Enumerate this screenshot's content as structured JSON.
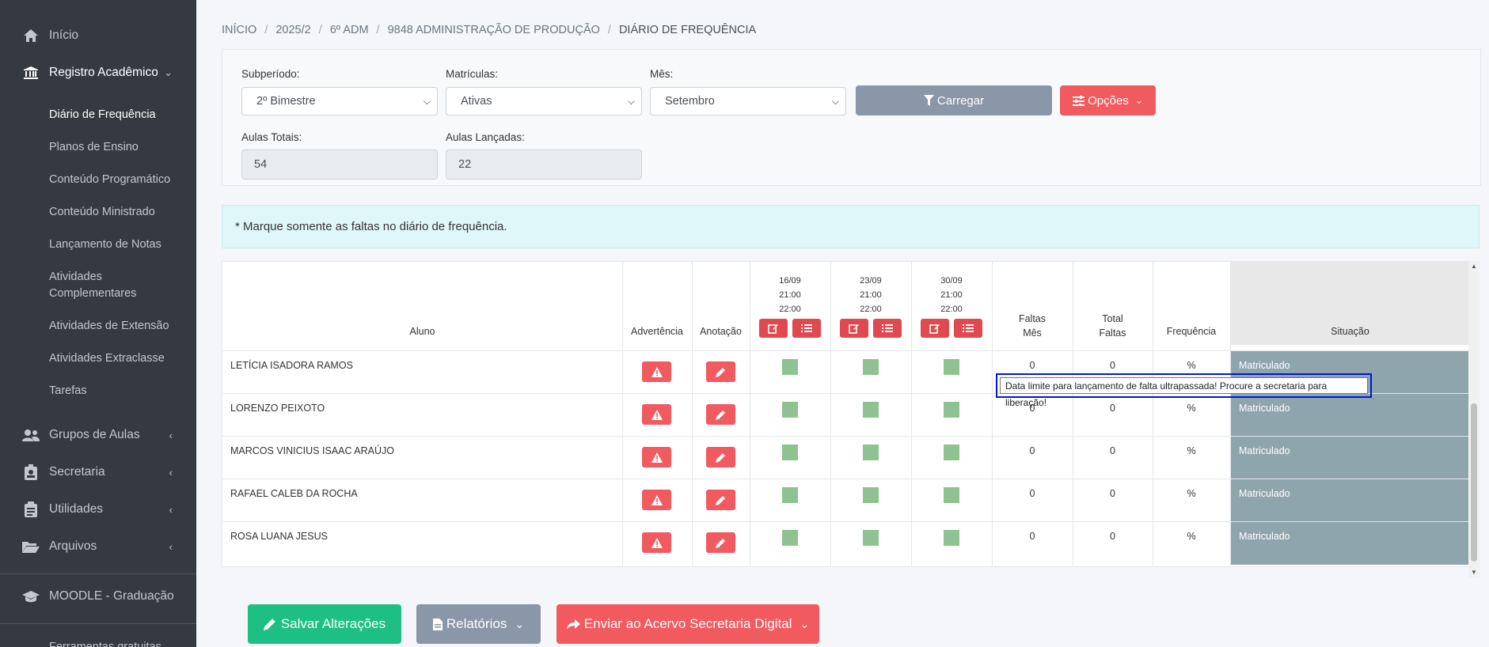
{
  "sidebar": {
    "inicio": "Início",
    "registro": "Registro Acadêmico",
    "sub_items": [
      "Diário de Frequência",
      "Planos de Ensino",
      "Conteúdo Programático",
      "Conteúdo Ministrado",
      "Lançamento de Notas",
      "Atividades Complementares",
      "Atividades de Extensão",
      "Atividades Extraclasse",
      "Tarefas"
    ],
    "grupos": "Grupos de Aulas",
    "secretaria": "Secretaria",
    "utilidades": "Utilidades",
    "arquivos": "Arquivos",
    "moodle": "MOODLE - Graduação",
    "ferramentas": "Ferramentas gratuitas"
  },
  "breadcrumb": [
    "INÍCIO",
    "2025/2",
    "6º ADM",
    "9848 ADMINISTRAÇÃO DE PRODUÇÃO",
    "DIÁRIO DE FREQUÊNCIA"
  ],
  "filters": {
    "subperiodo_label": "Subperíodo:",
    "subperiodo_value": "2º Bimestre",
    "matriculas_label": "Matrículas:",
    "matriculas_value": "Ativas",
    "mes_label": "Mês:",
    "mes_value": "Setembro",
    "carregar": "Carregar",
    "opcoes": "Opções",
    "aulas_totais_label": "Aulas Totais:",
    "aulas_totais_value": "54",
    "aulas_lancadas_label": "Aulas Lançadas:",
    "aulas_lancadas_value": "22"
  },
  "alert": "* Marque somente as faltas no diário de frequência.",
  "table": {
    "headers": {
      "aluno": "Aluno",
      "advertencia": "Advertência",
      "anotacao": "Anotação",
      "faltas_mes": [
        "Faltas",
        "Mês"
      ],
      "total_faltas": [
        "Total",
        "Faltas"
      ],
      "frequencia": "Frequência",
      "situacao": "Situação"
    },
    "dates": [
      {
        "date": "16/09",
        "start": "21:00",
        "end": "22:00"
      },
      {
        "date": "23/09",
        "start": "21:00",
        "end": "22:00"
      },
      {
        "date": "30/09",
        "start": "21:00",
        "end": "22:00"
      }
    ],
    "rows": [
      {
        "name": "LETÍCIA ISADORA RAMOS",
        "faltas_mes": "0",
        "total": "0",
        "freq": "%",
        "situacao": "Matriculado"
      },
      {
        "name": "LORENZO PEIXOTO",
        "faltas_mes": "0",
        "total": "0",
        "freq": "%",
        "situacao": "Matriculado"
      },
      {
        "name": "MARCOS VINICIUS ISAAC ARAÚJO",
        "faltas_mes": "0",
        "total": "0",
        "freq": "%",
        "situacao": "Matriculado"
      },
      {
        "name": "RAFAEL CALEB DA ROCHA",
        "faltas_mes": "0",
        "total": "0",
        "freq": "%",
        "situacao": "Matriculado"
      },
      {
        "name": "ROSA LUANA JESUS",
        "faltas_mes": "0",
        "total": "0",
        "freq": "%",
        "situacao": "Matriculado"
      }
    ]
  },
  "tooltip": "Data limite para lançamento de falta ultrapassada! Procure a secretaria para liberação!",
  "actions": {
    "salvar": "Salvar Alterações",
    "relatorios": "Relatórios",
    "enviar": "Enviar ao Acervo Secretaria Digital"
  },
  "colors": {
    "sidebar_bg": "#343a40",
    "danger": "#f15a5f",
    "success": "#1dbf82",
    "secondary": "#8a97a8",
    "status_bg": "#8fa5ae",
    "check_green": "#8fc291"
  }
}
